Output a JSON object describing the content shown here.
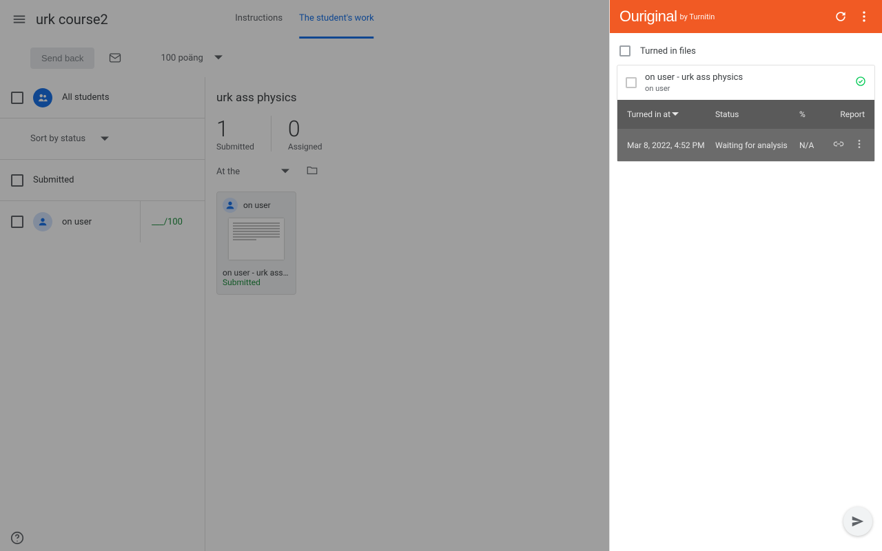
{
  "header": {
    "title": "urk course2",
    "tabs": [
      "Instructions",
      "The student's work"
    ]
  },
  "toolbar": {
    "send_back": "Send back",
    "points": "100 poäng"
  },
  "sidebar": {
    "all_students": "All students",
    "sort": "Sort by status",
    "group": "Submitted",
    "student": {
      "name": "on user",
      "grade_suffix": "/100"
    }
  },
  "content": {
    "assignment_title": "urk ass physics",
    "stats": {
      "submitted_n": "1",
      "submitted_l": "Submitted",
      "assigned_n": "0",
      "assigned_l": "Assigned"
    },
    "filter": "At the",
    "card": {
      "author": "on user",
      "filename": "on user - urk ass physi...",
      "status": "Submitted"
    }
  },
  "panel": {
    "brand_main": "Ouriginal",
    "brand_tag": "by Turnitin",
    "section": "Turned in files",
    "file_name": "on user - urk ass physics",
    "file_user": "on user",
    "thead": {
      "date": "Turned in at",
      "status": "Status",
      "pct": "%",
      "report": "Report"
    },
    "trow": {
      "date": "Mar 8, 2022, 4:52 PM",
      "status": "Waiting for analysis",
      "pct": "N/A"
    }
  }
}
